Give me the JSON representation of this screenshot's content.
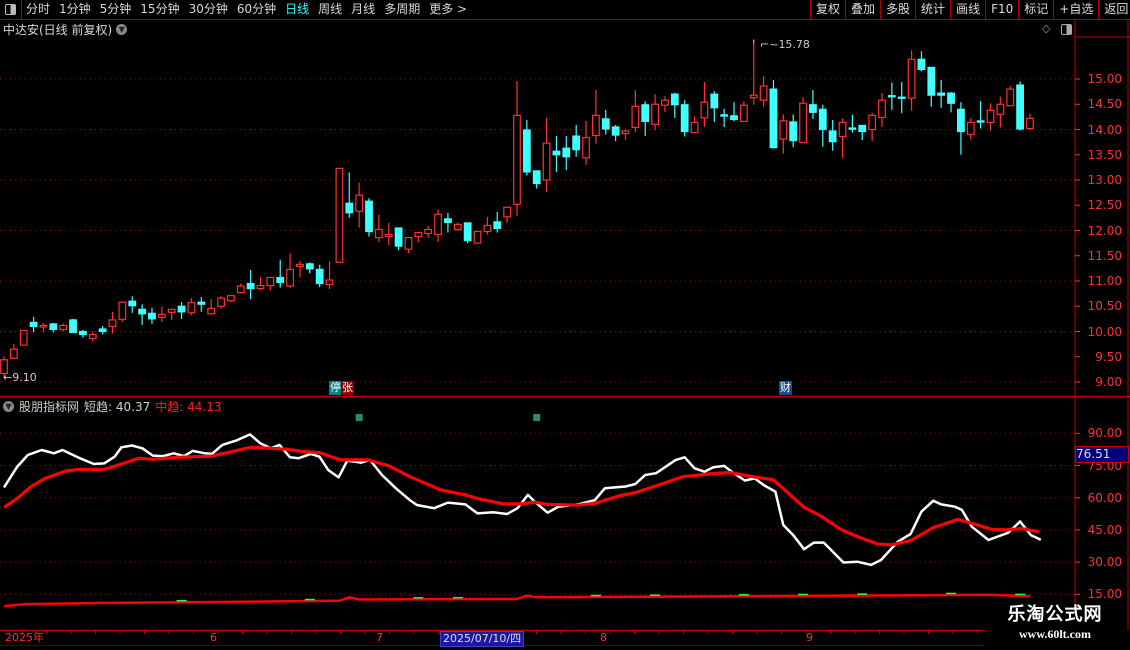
{
  "toolbar": {
    "periods": [
      "分时",
      "1分钟",
      "5分钟",
      "15分钟",
      "30分钟",
      "60分钟",
      "日线",
      "周线",
      "月线",
      "多周期",
      "更多 >"
    ],
    "active_period": "日线",
    "tools": [
      "复权",
      "叠加",
      "多股",
      "统计",
      "画线",
      "F10",
      "标记",
      "+自选",
      "返回"
    ]
  },
  "title": "中达安(日线 前复权)",
  "price_panel": {
    "high_label": "15.78",
    "low_label": "9.10",
    "tags": [
      {
        "text": "停",
        "color": "#008080"
      },
      {
        "text": "张",
        "color": "#8b0000"
      },
      {
        "text": "财",
        "color": "#1a4a8a"
      }
    ]
  },
  "indicator": {
    "name": "股朋指标网",
    "short_label": "短趋:",
    "short_value": "40.37",
    "mid_label": "中趋:",
    "mid_value": "44.13",
    "cursor_value": "76.51"
  },
  "date_axis": {
    "labels": [
      "2025年",
      "6",
      "7",
      "8",
      "9"
    ],
    "cursor_date": "2025/07/10/四"
  },
  "watermark": {
    "title": "乐淘公式网",
    "url": "www.60lt.com"
  },
  "colors": {
    "up": "#ff3030",
    "down": "#40ffff",
    "grid": "#a00000",
    "axis": "#ff3030",
    "short": "#ffffff",
    "mid": "#ff0000",
    "signal": "#2a8a6a"
  },
  "chart_data": {
    "type": "candlestick",
    "price_axis": {
      "min": 9.0,
      "max": 15.0,
      "ticks": [
        "15.00",
        "14.50",
        "14.00",
        "13.50",
        "13.00",
        "12.50",
        "12.00",
        "11.50",
        "11.00",
        "10.50",
        "10.00",
        "9.50",
        "9.00"
      ]
    },
    "ohlc": [
      [
        9.17,
        9.51,
        9.1,
        9.44
      ],
      [
        9.47,
        9.75,
        9.47,
        9.65
      ],
      [
        9.73,
        10.02,
        9.73,
        10.02
      ],
      [
        10.18,
        10.29,
        9.99,
        10.1
      ],
      [
        10.09,
        10.17,
        9.98,
        10.12
      ],
      [
        10.15,
        10.17,
        9.98,
        10.04
      ],
      [
        10.04,
        10.16,
        10.0,
        10.12
      ],
      [
        10.23,
        10.25,
        9.97,
        9.98
      ],
      [
        10.0,
        10.03,
        9.88,
        9.94
      ],
      [
        9.86,
        10.0,
        9.8,
        9.94
      ],
      [
        10.05,
        10.11,
        9.94,
        10.0
      ],
      [
        10.1,
        10.39,
        9.96,
        10.23
      ],
      [
        10.24,
        10.58,
        10.19,
        10.58
      ],
      [
        10.6,
        10.7,
        10.37,
        10.51
      ],
      [
        10.44,
        10.54,
        10.13,
        10.35
      ],
      [
        10.36,
        10.47,
        10.15,
        10.25
      ],
      [
        10.28,
        10.49,
        10.19,
        10.34
      ],
      [
        10.38,
        10.44,
        10.23,
        10.44
      ],
      [
        10.5,
        10.58,
        10.25,
        10.39
      ],
      [
        10.37,
        10.66,
        10.32,
        10.57
      ],
      [
        10.58,
        10.68,
        10.39,
        10.54
      ],
      [
        10.35,
        10.64,
        10.35,
        10.46
      ],
      [
        10.5,
        10.7,
        10.45,
        10.66
      ],
      [
        10.61,
        10.73,
        10.58,
        10.71
      ],
      [
        10.77,
        10.95,
        10.75,
        10.9
      ],
      [
        10.95,
        11.22,
        10.64,
        10.85
      ],
      [
        10.85,
        11.08,
        10.82,
        10.91
      ],
      [
        10.91,
        11.07,
        10.82,
        11.07
      ],
      [
        11.07,
        11.42,
        10.87,
        10.97
      ],
      [
        10.9,
        11.55,
        10.86,
        11.23
      ],
      [
        11.29,
        11.4,
        11.07,
        11.33
      ],
      [
        11.34,
        11.37,
        11.15,
        11.24
      ],
      [
        11.23,
        11.32,
        10.88,
        10.95
      ],
      [
        10.93,
        11.39,
        10.84,
        11.02
      ],
      [
        11.37,
        13.23,
        11.37,
        13.23
      ],
      [
        12.54,
        13.15,
        12.25,
        12.35
      ],
      [
        12.38,
        12.95,
        12.06,
        12.7
      ],
      [
        12.58,
        12.64,
        11.88,
        11.98
      ],
      [
        11.86,
        12.31,
        11.77,
        12.02
      ],
      [
        11.88,
        12.15,
        11.71,
        11.92
      ],
      [
        12.05,
        12.05,
        11.61,
        11.69
      ],
      [
        11.63,
        11.86,
        11.55,
        11.86
      ],
      [
        11.88,
        11.96,
        11.77,
        11.96
      ],
      [
        11.94,
        12.09,
        11.85,
        12.02
      ],
      [
        11.92,
        12.42,
        11.77,
        12.32
      ],
      [
        12.23,
        12.35,
        11.96,
        12.16
      ],
      [
        12.02,
        12.16,
        11.99,
        12.12
      ],
      [
        12.15,
        12.15,
        11.75,
        11.8
      ],
      [
        11.75,
        12.0,
        11.74,
        11.98
      ],
      [
        11.98,
        12.27,
        11.92,
        12.1
      ],
      [
        12.17,
        12.37,
        11.96,
        12.04
      ],
      [
        12.27,
        12.46,
        12.15,
        12.46
      ],
      [
        12.52,
        14.96,
        12.29,
        14.28
      ],
      [
        13.99,
        14.19,
        13.09,
        13.16
      ],
      [
        13.18,
        13.19,
        12.83,
        12.93
      ],
      [
        13.0,
        14.23,
        12.76,
        13.73
      ],
      [
        13.57,
        13.87,
        13.16,
        13.5
      ],
      [
        13.63,
        13.87,
        13.2,
        13.46
      ],
      [
        13.87,
        14.09,
        13.46,
        13.6
      ],
      [
        13.44,
        14.17,
        13.3,
        13.84
      ],
      [
        13.88,
        14.78,
        13.72,
        14.28
      ],
      [
        14.21,
        14.39,
        13.9,
        14.01
      ],
      [
        14.05,
        14.09,
        13.77,
        13.89
      ],
      [
        13.92,
        14.01,
        13.79,
        13.97
      ],
      [
        14.04,
        14.78,
        13.94,
        14.46
      ],
      [
        14.49,
        14.56,
        13.87,
        14.16
      ],
      [
        14.1,
        14.7,
        13.99,
        14.5
      ],
      [
        14.48,
        14.66,
        14.35,
        14.58
      ],
      [
        14.7,
        14.73,
        14.23,
        14.49
      ],
      [
        14.49,
        14.58,
        13.86,
        13.96
      ],
      [
        13.94,
        14.26,
        13.94,
        14.14
      ],
      [
        14.23,
        14.94,
        14.05,
        14.54
      ],
      [
        14.7,
        14.76,
        14.15,
        14.43
      ],
      [
        14.29,
        14.41,
        14.05,
        14.28
      ],
      [
        14.27,
        14.54,
        14.16,
        14.2
      ],
      [
        14.16,
        14.56,
        14.14,
        14.48
      ],
      [
        14.63,
        15.78,
        14.49,
        14.68
      ],
      [
        14.58,
        15.06,
        14.45,
        14.86
      ],
      [
        14.8,
        14.98,
        13.64,
        13.64
      ],
      [
        13.81,
        14.3,
        13.52,
        14.17
      ],
      [
        14.15,
        14.3,
        13.65,
        13.78
      ],
      [
        13.74,
        14.64,
        13.74,
        14.52
      ],
      [
        14.49,
        14.78,
        14.21,
        14.34
      ],
      [
        14.4,
        14.49,
        13.66,
        14.0
      ],
      [
        13.97,
        14.19,
        13.58,
        13.76
      ],
      [
        13.86,
        14.22,
        13.44,
        14.14
      ],
      [
        14.03,
        14.29,
        13.94,
        14.02
      ],
      [
        14.08,
        14.08,
        13.79,
        13.96
      ],
      [
        14.0,
        14.33,
        13.77,
        14.28
      ],
      [
        14.24,
        14.72,
        14.05,
        14.58
      ],
      [
        14.67,
        14.93,
        14.39,
        14.66
      ],
      [
        14.64,
        14.94,
        14.32,
        14.63
      ],
      [
        14.62,
        15.57,
        14.37,
        15.39
      ],
      [
        15.39,
        15.55,
        15.15,
        15.19
      ],
      [
        15.23,
        15.23,
        14.45,
        14.68
      ],
      [
        14.72,
        14.98,
        14.43,
        14.68
      ],
      [
        14.72,
        14.74,
        14.34,
        14.52
      ],
      [
        14.4,
        14.54,
        13.5,
        13.96
      ],
      [
        13.9,
        14.23,
        13.8,
        14.14
      ],
      [
        14.17,
        14.56,
        14.02,
        14.16
      ],
      [
        14.14,
        14.52,
        13.98,
        14.38
      ],
      [
        14.3,
        14.65,
        14.04,
        14.5
      ],
      [
        14.47,
        14.86,
        14.47,
        14.8
      ],
      [
        14.88,
        14.95,
        13.98,
        14.01
      ],
      [
        14.02,
        14.32,
        13.99,
        14.22
      ]
    ],
    "high_index": 76,
    "low_index": 0,
    "tag_indices": [
      34,
      34,
      79
    ],
    "indicator_axis": {
      "min": 15,
      "max": 90,
      "ticks": [
        "90.00",
        "75.00",
        "60.00",
        "45.00",
        "30.00",
        "15.00"
      ]
    },
    "series": [
      {
        "name": "短趋",
        "points": [
          [
            0,
            64.8
          ],
          [
            1.35,
            74.5
          ],
          [
            2.41,
            79.9
          ],
          [
            3.82,
            82.2
          ],
          [
            5.05,
            80.7
          ],
          [
            5.93,
            82.2
          ],
          [
            7.69,
            78.4
          ],
          [
            9.1,
            75.7
          ],
          [
            10.15,
            76.0
          ],
          [
            11.21,
            79.1
          ],
          [
            11.91,
            83.5
          ],
          [
            12.97,
            84.3
          ],
          [
            14.03,
            83.0
          ],
          [
            15.08,
            79.6
          ],
          [
            16.14,
            79.4
          ],
          [
            17.2,
            80.7
          ],
          [
            18.25,
            79.4
          ],
          [
            19.13,
            81.8
          ],
          [
            20.36,
            80.7
          ],
          [
            21.07,
            80.4
          ],
          [
            22.13,
            84.6
          ],
          [
            23.53,
            86.6
          ],
          [
            24.94,
            89.5
          ],
          [
            26.0,
            85.3
          ],
          [
            27.05,
            83.0
          ],
          [
            27.93,
            84.6
          ],
          [
            28.99,
            78.8
          ],
          [
            29.87,
            78.4
          ],
          [
            31.1,
            80.4
          ],
          [
            31.98,
            79.1
          ],
          [
            32.86,
            72.9
          ],
          [
            33.92,
            69.5
          ],
          [
            34.8,
            77.3
          ],
          [
            36.2,
            76.3
          ],
          [
            37.09,
            77.6
          ],
          [
            38.32,
            70.6
          ],
          [
            39.73,
            64.4
          ],
          [
            41.14,
            58.9
          ],
          [
            41.84,
            56.6
          ],
          [
            43.6,
            55.1
          ],
          [
            45.0,
            57.7
          ],
          [
            46.77,
            56.9
          ],
          [
            48.0,
            52.7
          ],
          [
            49.59,
            53.2
          ],
          [
            51.0,
            52.4
          ],
          [
            52.05,
            55.1
          ],
          [
            53.11,
            61.3
          ],
          [
            53.8,
            58.2
          ],
          [
            55.1,
            53.0
          ],
          [
            56.2,
            55.8
          ],
          [
            58.2,
            56.9
          ],
          [
            59.9,
            58.9
          ],
          [
            60.9,
            64.4
          ],
          [
            63.0,
            65.2
          ],
          [
            64.0,
            66.4
          ],
          [
            65.0,
            70.6
          ],
          [
            66.1,
            71.4
          ],
          [
            68.1,
            77.6
          ],
          [
            69.0,
            78.8
          ],
          [
            70.0,
            73.7
          ],
          [
            71.0,
            72.1
          ],
          [
            71.9,
            74.2
          ],
          [
            73.0,
            74.8
          ],
          [
            73.9,
            71.7
          ],
          [
            75.1,
            68.0
          ],
          [
            76.1,
            69.0
          ],
          [
            77.0,
            65.9
          ],
          [
            78.2,
            62.8
          ],
          [
            79.0,
            47.3
          ],
          [
            80.0,
            42.6
          ],
          [
            81.1,
            36.0
          ],
          [
            82.1,
            39.1
          ],
          [
            83.1,
            39.1
          ],
          [
            85.1,
            29.8
          ],
          [
            86.5,
            30.2
          ],
          [
            87.9,
            28.7
          ],
          [
            88.9,
            31.0
          ],
          [
            90.6,
            39.5
          ],
          [
            91.9,
            43.1
          ],
          [
            93.0,
            53.5
          ],
          [
            94.2,
            58.6
          ],
          [
            95.0,
            56.9
          ],
          [
            96.4,
            55.8
          ],
          [
            97.1,
            54.3
          ],
          [
            98.1,
            46.5
          ],
          [
            99.8,
            40.3
          ],
          [
            101.8,
            43.7
          ],
          [
            103.0,
            48.9
          ],
          [
            104.1,
            42.6
          ],
          [
            105.1,
            40.4
          ]
        ]
      },
      {
        "name": "中趋",
        "points": [
          [
            0,
            55.5
          ],
          [
            1.35,
            59.7
          ],
          [
            2.76,
            65.2
          ],
          [
            4.17,
            69.0
          ],
          [
            6.28,
            72.5
          ],
          [
            7.69,
            73.2
          ],
          [
            10.15,
            73.2
          ],
          [
            11.56,
            75.2
          ],
          [
            13.67,
            78.4
          ],
          [
            15.08,
            77.9
          ],
          [
            17.2,
            78.7
          ],
          [
            19.31,
            79.1
          ],
          [
            21.07,
            79.4
          ],
          [
            23.53,
            81.9
          ],
          [
            24.94,
            83.5
          ],
          [
            27.05,
            83.0
          ],
          [
            28.82,
            82.5
          ],
          [
            30.22,
            81.5
          ],
          [
            31.98,
            81.0
          ],
          [
            34.1,
            77.6
          ],
          [
            36.91,
            77.6
          ],
          [
            39.02,
            74.8
          ],
          [
            41.14,
            69.8
          ],
          [
            44.3,
            63.6
          ],
          [
            46.77,
            61.3
          ],
          [
            48.18,
            59.4
          ],
          [
            50.65,
            57.1
          ],
          [
            52.4,
            57.1
          ],
          [
            53.8,
            57.9
          ],
          [
            55.1,
            56.9
          ],
          [
            58.2,
            56.5
          ],
          [
            59.9,
            57.4
          ],
          [
            62.3,
            60.8
          ],
          [
            64.0,
            62.4
          ],
          [
            66.1,
            65.5
          ],
          [
            68.8,
            69.8
          ],
          [
            71.5,
            71.1
          ],
          [
            73.6,
            71.7
          ],
          [
            75.9,
            69.8
          ],
          [
            78.0,
            68.3
          ],
          [
            79.7,
            61.3
          ],
          [
            81.1,
            55.5
          ],
          [
            82.8,
            51.5
          ],
          [
            84.8,
            45.3
          ],
          [
            86.5,
            41.9
          ],
          [
            88.6,
            38.4
          ],
          [
            89.9,
            38.0
          ],
          [
            91.9,
            40.0
          ],
          [
            94.2,
            46.1
          ],
          [
            96.7,
            49.9
          ],
          [
            98.1,
            48.1
          ],
          [
            100.1,
            45.3
          ],
          [
            101.5,
            45.0
          ],
          [
            103.2,
            45.6
          ],
          [
            104.9,
            44.1
          ]
        ]
      },
      {
        "name": "base",
        "points": [
          [
            0,
            9.5
          ],
          [
            2,
            10.4
          ],
          [
            10,
            11.0
          ],
          [
            20,
            11.4
          ],
          [
            34,
            12.0
          ],
          [
            35,
            13.6
          ],
          [
            36,
            12.6
          ],
          [
            52,
            12.8
          ],
          [
            53,
            14.4
          ],
          [
            54,
            13.6
          ],
          [
            70,
            14.0
          ],
          [
            80,
            14.2
          ],
          [
            92,
            14.6
          ],
          [
            100,
            14.8
          ],
          [
            104,
            14.1
          ]
        ]
      }
    ],
    "signal_indices": [
      36,
      54
    ],
    "green_mark_indices": [
      18,
      31,
      42,
      46,
      60,
      66,
      75,
      81,
      87,
      96,
      103
    ]
  }
}
